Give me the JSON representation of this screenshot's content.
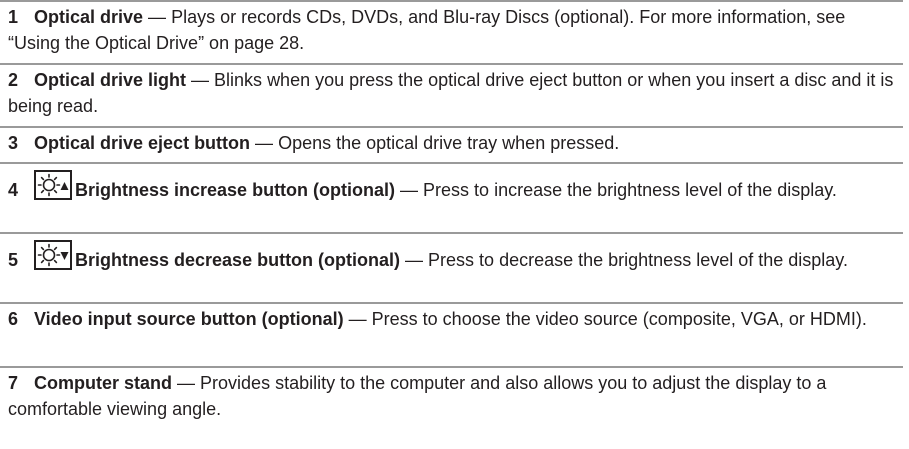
{
  "items": [
    {
      "number": "1",
      "title": "Optical drive",
      "dash": " — ",
      "description": "Plays or records CDs, DVDs, and Blu-ray Discs (optional). For more information, see “Using the Optical Drive” on page 28."
    },
    {
      "number": "2",
      "title": "Optical drive light",
      "dash": " — ",
      "description": "Blinks when you press the optical drive eject button or when you insert a disc and it is being read."
    },
    {
      "number": "3",
      "title": "Optical drive eject button",
      "dash": " — ",
      "description": "Opens the optical drive tray when pressed."
    },
    {
      "number": "4",
      "icon": "brightness-increase-icon",
      "title": "Brightness increase button (optional)",
      "dash": " — ",
      "description": "Press to increase the brightness level of the display."
    },
    {
      "number": "5",
      "icon": "brightness-decrease-icon",
      "title": "Brightness decrease button (optional)",
      "dash": " — ",
      "description": "Press to decrease the brightness level of the display."
    },
    {
      "number": "6",
      "title": "Video input source button (optional)",
      "dash": " — ",
      "description": "Press to choose the video source (composite, VGA, or HDMI)."
    },
    {
      "number": "7",
      "title": "Computer stand",
      "dash": " — ",
      "description": "Provides stability to the computer and also allows you to adjust the display to a comfortable viewing angle."
    }
  ],
  "colors": {
    "text": "#231f20",
    "rule": "#9a9a9a"
  }
}
